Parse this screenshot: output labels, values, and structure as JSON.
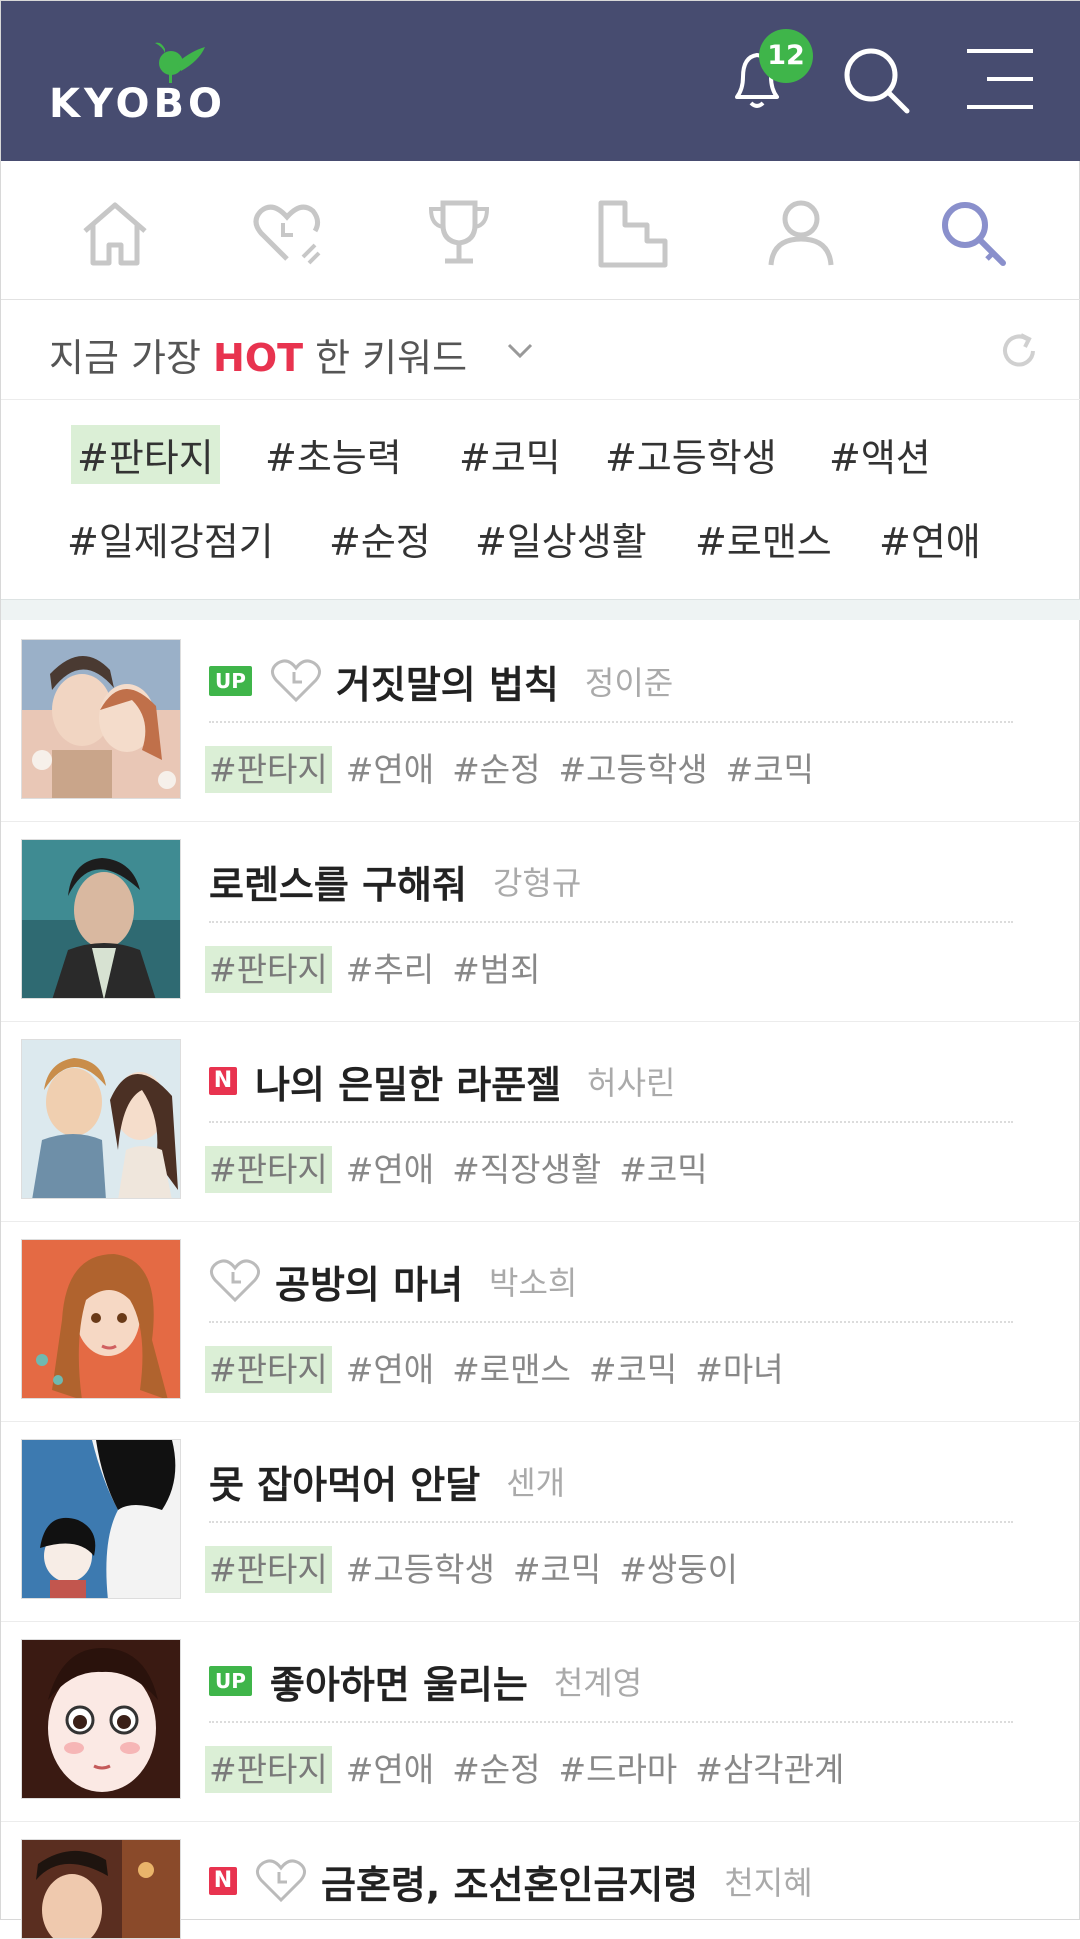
{
  "header": {
    "logo_text": "KYOBO",
    "notification_count": "12"
  },
  "nav": {
    "items": [
      "home-icon",
      "favorites-icon",
      "ranking-icon",
      "genre-icon",
      "my-page-icon",
      "search-key-icon"
    ],
    "active_index": 5
  },
  "hot": {
    "prefix": "지금 가장",
    "highlight": "HOT",
    "suffix": "한 키워드"
  },
  "keywords": [
    "#판타지",
    "#초능력",
    "#코믹",
    "#고등학생",
    "#액션",
    "#일제강점기",
    "#순정",
    "#일상생활",
    "#로맨스",
    "#연애"
  ],
  "list": [
    {
      "badge": "UP",
      "heart": true,
      "title": "거짓말의 법칙",
      "author": "정이준",
      "tags": [
        "#판타지",
        "#연애",
        "#순정",
        "#고등학생",
        "#코믹"
      ]
    },
    {
      "badge": "",
      "heart": false,
      "title": "로렌스를 구해줘",
      "author": "강형규",
      "tags": [
        "#판타지",
        "#추리",
        "#범죄"
      ]
    },
    {
      "badge": "N",
      "heart": false,
      "title": "나의 은밀한 라푼젤",
      "author": "허사린",
      "tags": [
        "#판타지",
        "#연애",
        "#직장생활",
        "#코믹"
      ]
    },
    {
      "badge": "",
      "heart": true,
      "title": "공방의 마녀",
      "author": "박소희",
      "tags": [
        "#판타지",
        "#연애",
        "#로맨스",
        "#코믹",
        "#마녀"
      ]
    },
    {
      "badge": "",
      "heart": false,
      "title": "못 잡아먹어 안달",
      "author": "센개",
      "tags": [
        "#판타지",
        "#고등학생",
        "#코믹",
        "#쌍둥이"
      ]
    },
    {
      "badge": "UP",
      "heart": false,
      "title": "좋아하면 울리는",
      "author": "천계영",
      "tags": [
        "#판타지",
        "#연애",
        "#순정",
        "#드라마",
        "#삼각관계"
      ]
    },
    {
      "badge": "N",
      "heart": true,
      "title": "금혼령, 조선혼인금지령",
      "author": "천지혜",
      "tags": []
    }
  ],
  "colors": {
    "header_bg": "#474c70",
    "hot": "#e8334f",
    "badge_green": "#3fb54a",
    "tag_highlight": "#dbefd6",
    "active_nav": "#8a90cc"
  }
}
